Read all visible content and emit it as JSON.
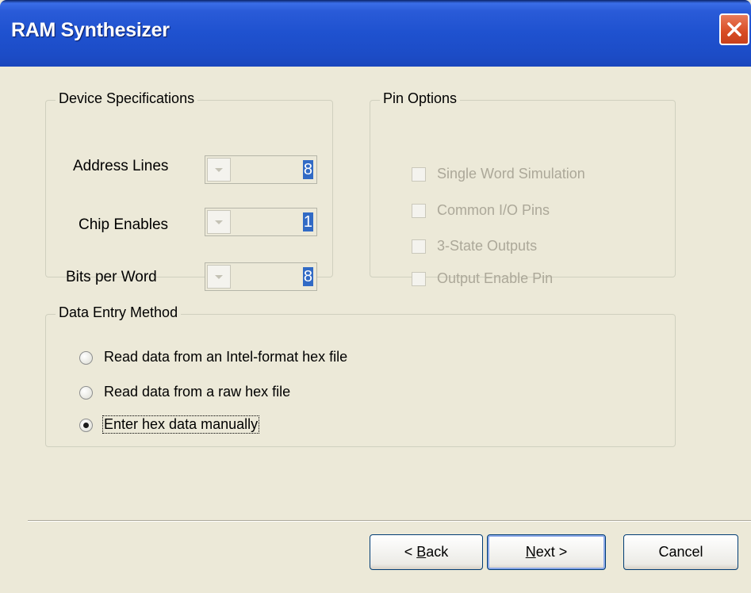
{
  "window": {
    "title": "RAM Synthesizer"
  },
  "device_specifications": {
    "legend": "Device Specifications",
    "fields": [
      {
        "label": "Address Lines",
        "value": "8"
      },
      {
        "label": "Chip Enables",
        "value": "1"
      },
      {
        "label": "Bits per Word",
        "value": "8"
      }
    ]
  },
  "pin_options": {
    "legend": "Pin Options",
    "options": [
      {
        "label": "Single Word Simulation",
        "checked": false,
        "enabled": false
      },
      {
        "label": "Common I/O Pins",
        "checked": false,
        "enabled": false
      },
      {
        "label": "3-State Outputs",
        "checked": false,
        "enabled": false
      },
      {
        "label": "Output Enable Pin",
        "checked": false,
        "enabled": false
      }
    ]
  },
  "data_entry_method": {
    "legend": "Data Entry Method",
    "options": [
      {
        "label": "Read data from an Intel-format hex file",
        "selected": false
      },
      {
        "label": "Read data from a raw hex file",
        "selected": false
      },
      {
        "label": "Enter hex data manually",
        "selected": true
      }
    ]
  },
  "buttons": {
    "back": {
      "pre": "< ",
      "mnemonic": "B",
      "rest": "ack"
    },
    "next": {
      "pre": "",
      "mnemonic": "N",
      "rest": "ext >"
    },
    "cancel": "Cancel"
  },
  "colors": {
    "titlebar": "#1f52d0",
    "face": "#ece9d8",
    "selection": "#316ac5",
    "disabled_text": "#aca899"
  }
}
